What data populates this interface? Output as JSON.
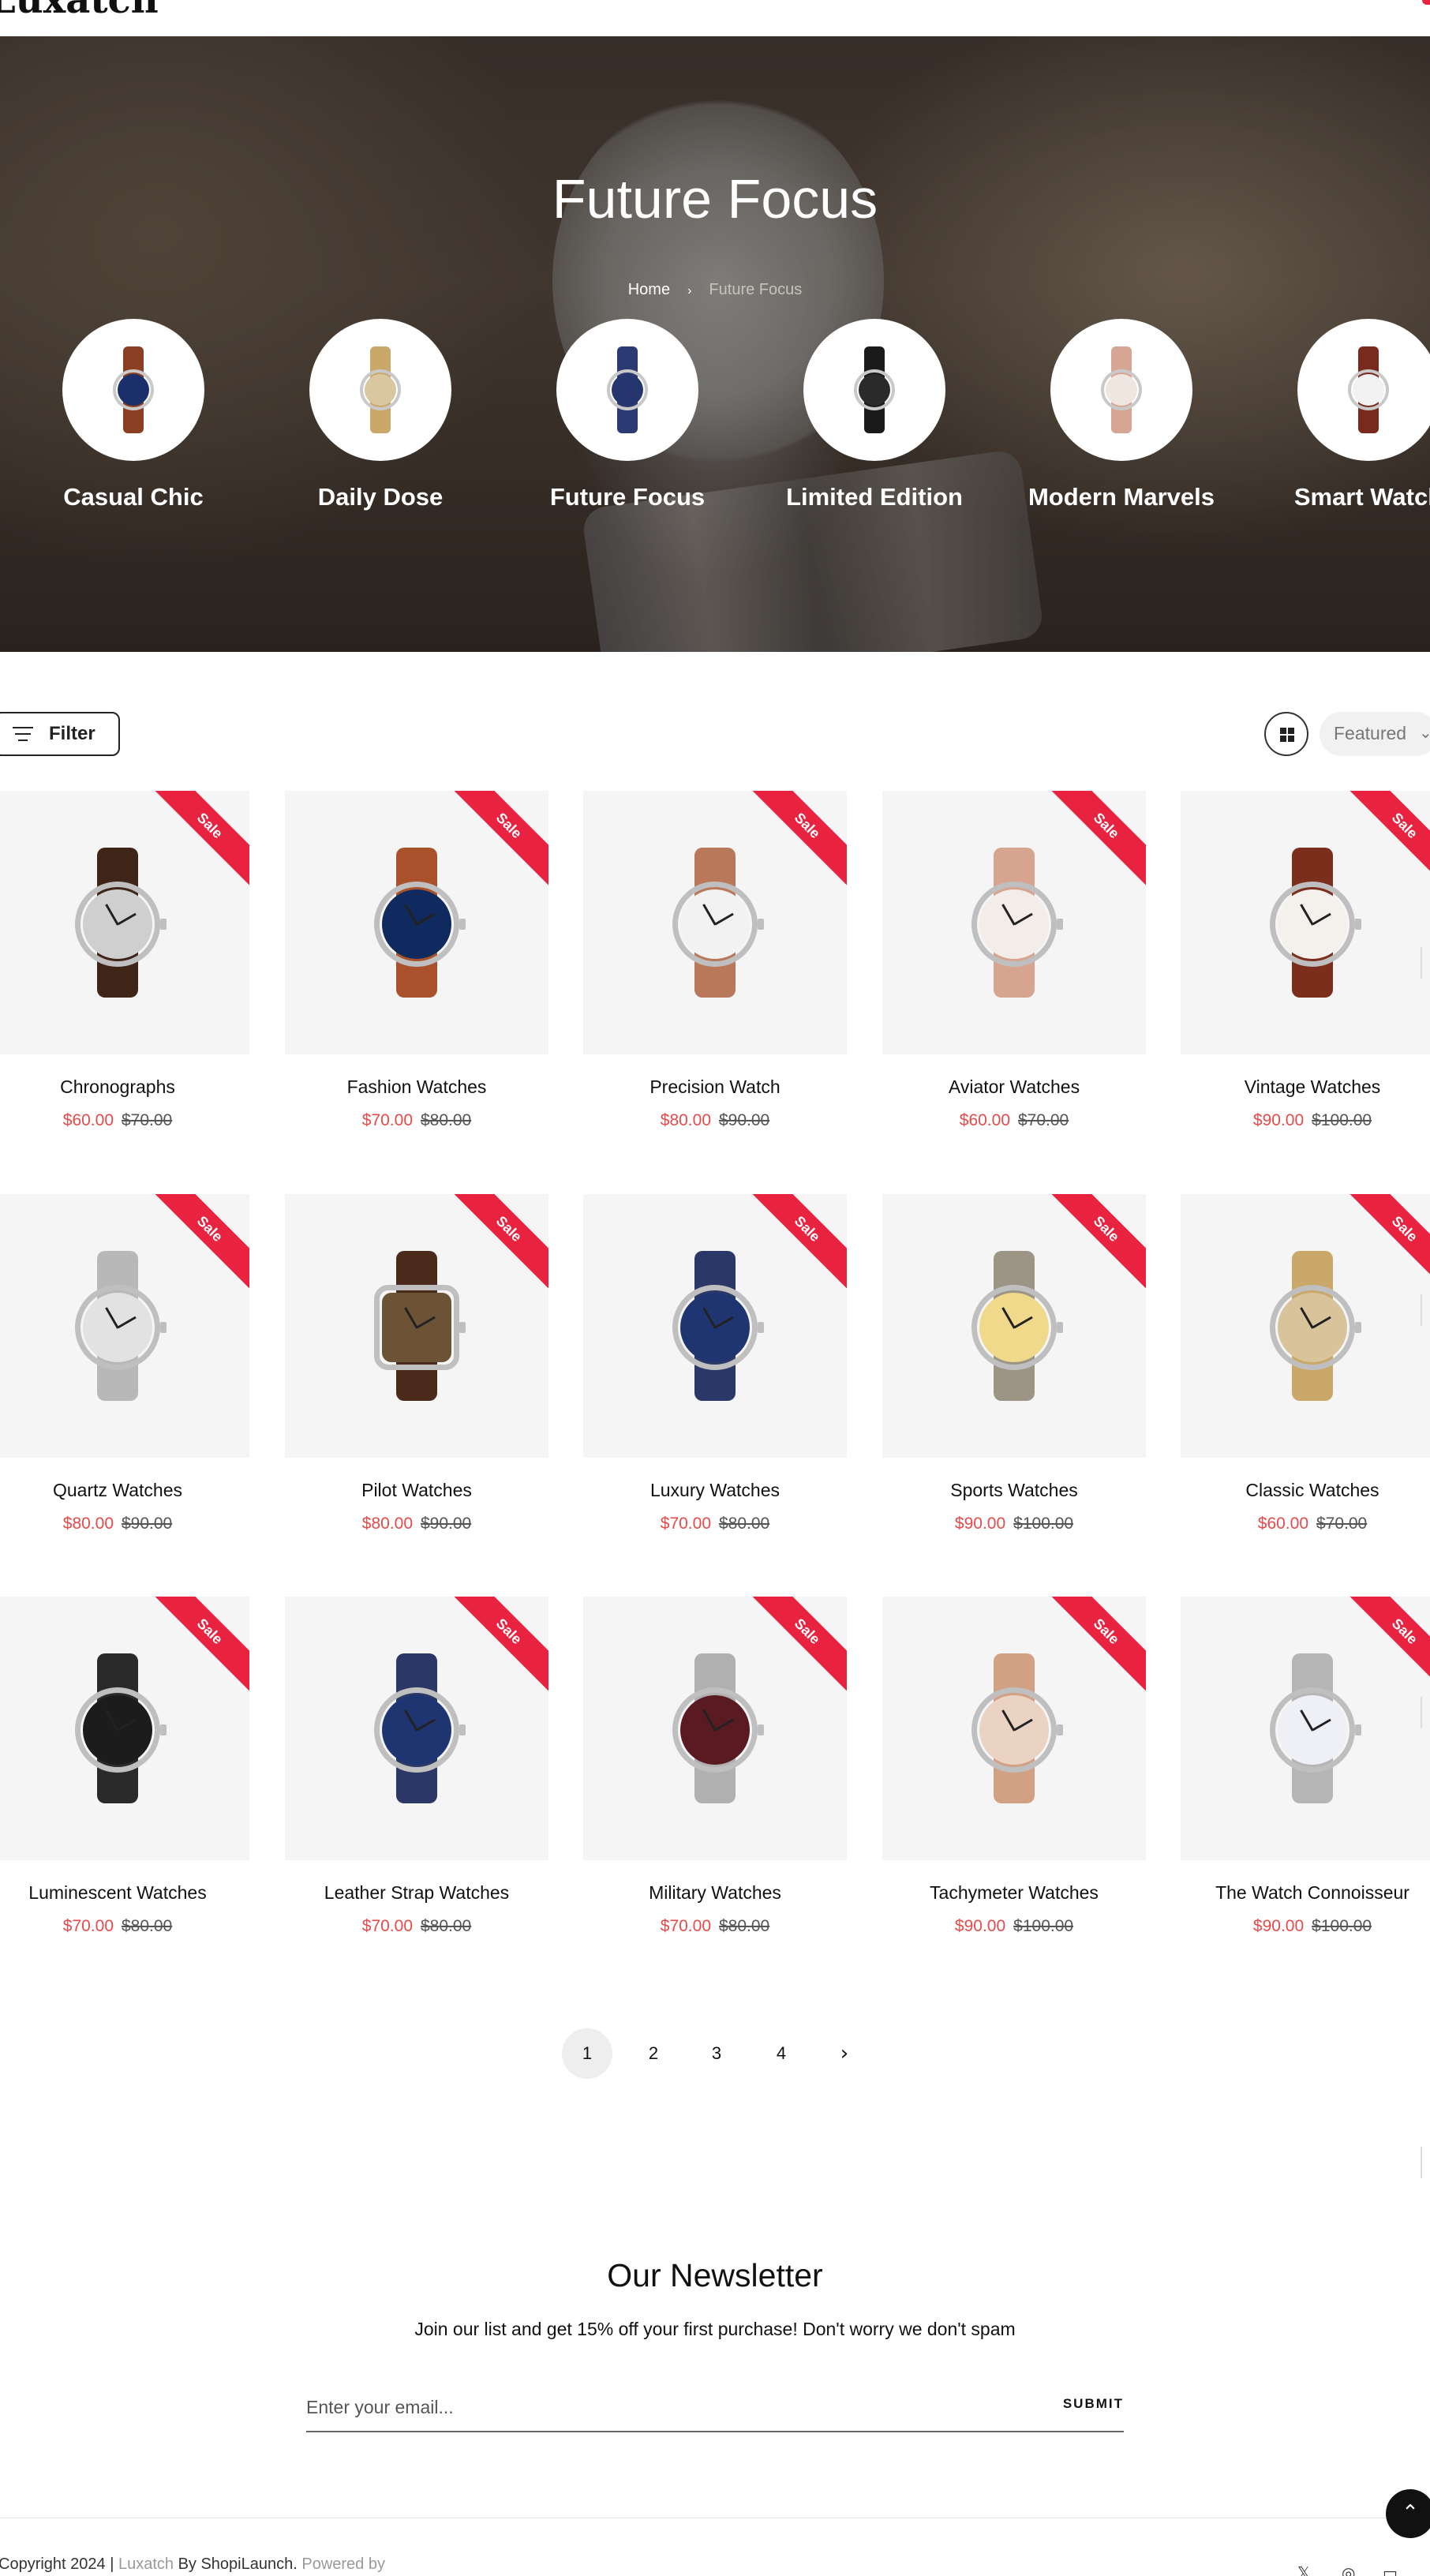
{
  "header": {
    "logo": "Luxatch"
  },
  "hero": {
    "title": "Future Focus",
    "breadcrumb": {
      "home": "Home",
      "separator": "›",
      "current": "Future Focus"
    }
  },
  "categories": [
    {
      "label": "Casual Chic",
      "strap": "#8b3f22",
      "face": "#1b2f6b"
    },
    {
      "label": "Daily Dose",
      "strap": "#c9a86a",
      "face": "#d9c7a0"
    },
    {
      "label": "Future Focus",
      "strap": "#2b3a73",
      "face": "#25356e"
    },
    {
      "label": "Limited Edition",
      "strap": "#1a1a1a",
      "face": "#2a2a2a"
    },
    {
      "label": "Modern Marvels",
      "strap": "#d7a593",
      "face": "#efe6e0"
    },
    {
      "label": "Smart Watch",
      "strap": "#7a2a1c",
      "face": "#f2f2f2"
    }
  ],
  "toolbar": {
    "filter_label": "Filter",
    "sort_label": "Featured",
    "sort_chevron": "⌄"
  },
  "sale_badge": "Sale",
  "products": [
    {
      "name": "Chronographs",
      "price": "$60.00",
      "old_price": "$70.00",
      "strap": "#3f2418",
      "face": "#cfcfcf",
      "shape": "round"
    },
    {
      "name": "Fashion Watches",
      "price": "$70.00",
      "old_price": "$80.00",
      "strap": "#a8512b",
      "face": "#0f2a5e",
      "shape": "round"
    },
    {
      "name": "Precision Watch",
      "price": "$80.00",
      "old_price": "$90.00",
      "strap": "#b9785a",
      "face": "#f2f2f2",
      "shape": "round"
    },
    {
      "name": "Aviator Watches",
      "price": "$60.00",
      "old_price": "$70.00",
      "strap": "#d6a48f",
      "face": "#f3ece8",
      "shape": "round"
    },
    {
      "name": "Vintage Watches",
      "price": "$90.00",
      "old_price": "$100.00",
      "strap": "#7b2e1c",
      "face": "#f4f0ec",
      "shape": "round"
    },
    {
      "name": "Quartz Watches",
      "price": "$80.00",
      "old_price": "$90.00",
      "strap": "#b8b8b8",
      "face": "#e2e2e2",
      "shape": "round"
    },
    {
      "name": "Pilot Watches",
      "price": "$80.00",
      "old_price": "$90.00",
      "strap": "#4a2a1a",
      "face": "#6d5336",
      "shape": "square"
    },
    {
      "name": "Luxury Watches",
      "price": "$70.00",
      "old_price": "$80.00",
      "strap": "#2b3766",
      "face": "#1f3572",
      "shape": "round"
    },
    {
      "name": "Sports Watches",
      "price": "$90.00",
      "old_price": "$100.00",
      "strap": "#9c9484",
      "face": "#f0d98a",
      "shape": "round"
    },
    {
      "name": "Classic Watches",
      "price": "$60.00",
      "old_price": "$70.00",
      "strap": "#c9a86a",
      "face": "#d8c39a",
      "shape": "round"
    },
    {
      "name": "Luminescent Watches",
      "price": "$70.00",
      "old_price": "$80.00",
      "strap": "#2a2a2a",
      "face": "#1c1c1c",
      "shape": "round"
    },
    {
      "name": "Leather Strap Watches",
      "price": "$70.00",
      "old_price": "$80.00",
      "strap": "#2b3766",
      "face": "#1f3572",
      "shape": "round"
    },
    {
      "name": "Military Watches",
      "price": "$70.00",
      "old_price": "$80.00",
      "strap": "#b0b0b0",
      "face": "#5a1a22",
      "shape": "round"
    },
    {
      "name": "Tachymeter Watches",
      "price": "$90.00",
      "old_price": "$100.00",
      "strap": "#d2a184",
      "face": "#ead3c3",
      "shape": "round"
    },
    {
      "name": "The Watch Connoisseur",
      "price": "$90.00",
      "old_price": "$100.00",
      "strap": "#b5b5b5",
      "face": "#eef0f6",
      "shape": "round"
    }
  ],
  "pagination": {
    "pages": [
      "1",
      "2",
      "3",
      "4"
    ],
    "active": "1",
    "next": "›"
  },
  "newsletter": {
    "title": "Our Newsletter",
    "subtitle": "Join our list and get 15% off your first purchase! Don't worry we don't spam",
    "placeholder": "Enter your email...",
    "submit": "SUBMIT"
  },
  "footer": {
    "copyright_prefix": "Copyright 2024 | ",
    "brand": "Luxatch",
    "by_text": " By ShopiLaunch. ",
    "powered": "Powered by",
    "back_to_top": "⌃",
    "social": [
      "𝕏",
      "◎",
      "▭"
    ]
  },
  "colors": {
    "accent": "#e8223f",
    "sale_price": "#e84a4a",
    "card_bg": "#f5f5f5"
  }
}
